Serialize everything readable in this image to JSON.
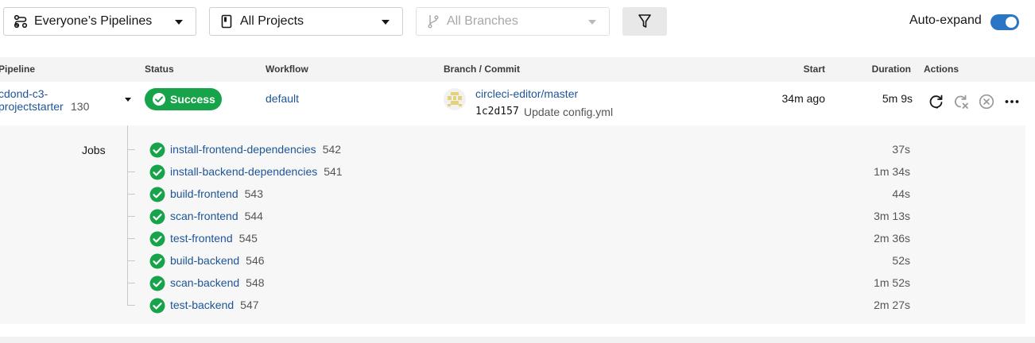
{
  "filters": {
    "pipelines_label": "Everyone’s Pipelines",
    "projects_label": "All Projects",
    "branches_label": "All Branches",
    "auto_expand_label": "Auto-expand",
    "auto_expand_on": true
  },
  "table": {
    "headers": {
      "pipeline": "Pipeline",
      "status": "Status",
      "workflow": "Workflow",
      "branch_commit": "Branch / Commit",
      "start": "Start",
      "duration": "Duration",
      "actions": "Actions"
    }
  },
  "pipeline": {
    "name_line1": "cdond-c3-",
    "name_line2": "projectstarter",
    "number": "130",
    "status": "Success",
    "workflow": "default",
    "branch": "circleci-editor/master",
    "commit_hash": "1c2d157",
    "commit_message": "Update config.yml",
    "start": "34m ago",
    "duration": "5m 9s"
  },
  "jobs_label": "Jobs",
  "jobs": [
    {
      "name": "install-frontend-dependencies",
      "number": "542",
      "duration": "37s"
    },
    {
      "name": "install-backend-dependencies",
      "number": "541",
      "duration": "1m 34s"
    },
    {
      "name": "build-frontend",
      "number": "543",
      "duration": "44s"
    },
    {
      "name": "scan-frontend",
      "number": "544",
      "duration": "3m 13s"
    },
    {
      "name": "test-frontend",
      "number": "545",
      "duration": "2m 36s"
    },
    {
      "name": "build-backend",
      "number": "546",
      "duration": "52s"
    },
    {
      "name": "scan-backend",
      "number": "548",
      "duration": "1m 52s"
    },
    {
      "name": "test-backend",
      "number": "547",
      "duration": "2m 27s"
    }
  ],
  "colors": {
    "success": "#17a34a",
    "link": "#1d5597",
    "toggle": "#2b75c7"
  }
}
